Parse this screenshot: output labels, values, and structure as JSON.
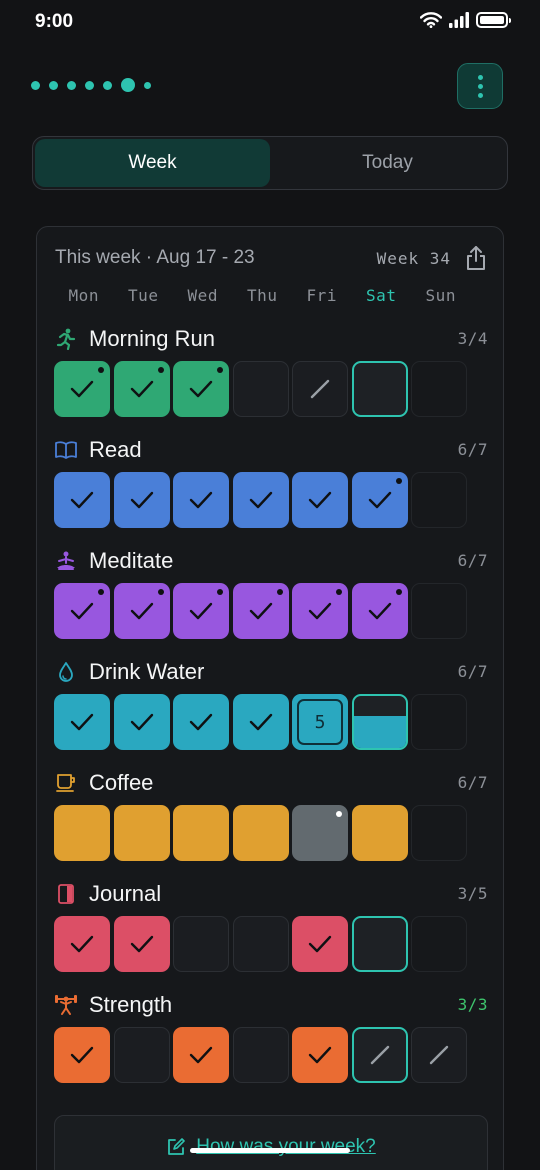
{
  "status_bar": {
    "time": "9:00"
  },
  "tabs": [
    {
      "label": "Week",
      "active": true
    },
    {
      "label": "Today",
      "active": false
    }
  ],
  "week": {
    "range": "This week · Aug 17 - 23",
    "number": "Week 34",
    "days": [
      "Mon",
      "Tue",
      "Wed",
      "Thu",
      "Fri",
      "Sat",
      "Sun"
    ],
    "today_index": 5
  },
  "colors": {
    "accent": "#2ec4b0",
    "run": "#2fa874",
    "read": "#4a7fd8",
    "meditate": "#9857df",
    "water": "#2aa8c0",
    "coffee": "#e0a030",
    "coffee_missed": "#626a6f",
    "journal": "#dc4f66",
    "strength": "#ea6c33"
  },
  "habits": [
    {
      "name": "Morning Run",
      "icon": "running-icon",
      "count": "3/4",
      "days": [
        "done-note",
        "done-note",
        "done-note",
        "empty",
        "skip",
        "today",
        "future"
      ]
    },
    {
      "name": "Read",
      "icon": "book-icon",
      "count": "6/7",
      "days": [
        "done",
        "done",
        "done",
        "done",
        "done",
        "done-note",
        "future"
      ]
    },
    {
      "name": "Meditate",
      "icon": "meditate-icon",
      "count": "6/7",
      "days": [
        "done-note",
        "done-note",
        "done-note",
        "done-note",
        "done-note",
        "done-note",
        "future"
      ]
    },
    {
      "name": "Drink Water",
      "icon": "droplet-icon",
      "count": "6/7",
      "friday_count": "5",
      "days": [
        "done",
        "done",
        "done",
        "done",
        "count",
        "partial",
        "future"
      ]
    },
    {
      "name": "Coffee",
      "icon": "coffee-icon",
      "count": "6/7",
      "days": [
        "filled",
        "filled",
        "filled",
        "filled",
        "missed-note",
        "filled",
        "future"
      ]
    },
    {
      "name": "Journal",
      "icon": "journal-icon",
      "count": "3/5",
      "days": [
        "done",
        "done",
        "empty",
        "empty",
        "done",
        "today",
        "future"
      ]
    },
    {
      "name": "Strength",
      "icon": "dumbbell-icon",
      "count": "3/3",
      "days": [
        "done",
        "empty",
        "done",
        "empty",
        "done",
        "today-skip",
        "skip"
      ]
    }
  ],
  "reflect": {
    "label": "How was your week?"
  }
}
